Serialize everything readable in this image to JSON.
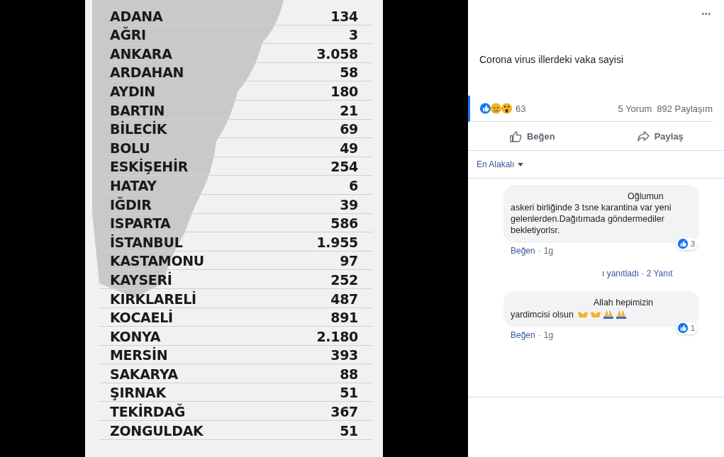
{
  "image": {
    "rows": [
      {
        "name": "ADANA",
        "value": "134"
      },
      {
        "name": "AĞRI",
        "value": "3"
      },
      {
        "name": "ANKARA",
        "value": "3.058"
      },
      {
        "name": "ARDAHAN",
        "value": "58"
      },
      {
        "name": "AYDIN",
        "value": "180"
      },
      {
        "name": "BARTIN",
        "value": "21"
      },
      {
        "name": "BİLECİK",
        "value": "69"
      },
      {
        "name": "BOLU",
        "value": "49"
      },
      {
        "name": "ESKİŞEHİR",
        "value": "254"
      },
      {
        "name": "HATAY",
        "value": "6"
      },
      {
        "name": "IĞDIR",
        "value": "39"
      },
      {
        "name": "ISPARTA",
        "value": "586"
      },
      {
        "name": "İSTANBUL",
        "value": "1.955"
      },
      {
        "name": "KASTAMONU",
        "value": "97"
      },
      {
        "name": "KAYSERİ",
        "value": "252"
      },
      {
        "name": "KIRKLARELİ",
        "value": "487"
      },
      {
        "name": "KOCAELİ",
        "value": "891"
      },
      {
        "name": "KONYA",
        "value": "2.180"
      },
      {
        "name": "MERSİN",
        "value": "393"
      },
      {
        "name": "SAKARYA",
        "value": "88"
      },
      {
        "name": "ŞIRNAK",
        "value": "51"
      },
      {
        "name": "TEKİRDAĞ",
        "value": "367"
      },
      {
        "name": "ZONGULDAK",
        "value": "51"
      }
    ]
  },
  "post": {
    "more": "•••",
    "text": "Corona virus illerdeki vaka sayisi",
    "reaction_count": "63",
    "comments": "5 Yorum",
    "shares": "892 Paylaşım",
    "actions": [
      {
        "kind": "like",
        "label": "Beğen"
      },
      {
        "kind": "share",
        "label": "Paylaş"
      }
    ],
    "sort": "En Alakalı"
  },
  "comments": [
    {
      "text": "Oğlumun askeri birliğinde 3 tsne karantina var yeni gelenlerden.Dağıtımada göndermediler bekletiyorlsr.",
      "likes": "3",
      "like_label": "Beğen",
      "age": "1g",
      "separator": "·",
      "emoji": false,
      "replies": "ı yanıtladı · 2 Yanıt"
    },
    {
      "text": "Allah hepimizin yardimcisi olsun",
      "likes": "1",
      "like_label": "Beğen",
      "age": "1g",
      "separator": "·",
      "emoji": true
    }
  ]
}
